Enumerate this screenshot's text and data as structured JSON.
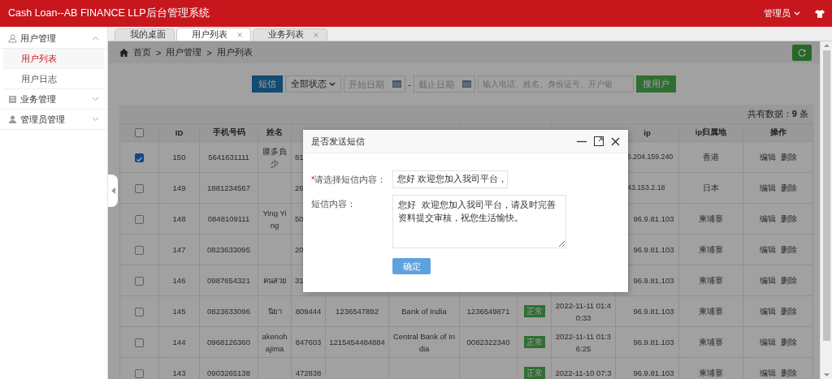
{
  "header": {
    "title": "Cash Loan--AB FINANCE LLP后台管理系统",
    "user": "管理员"
  },
  "sidebar": {
    "groups": [
      {
        "label": "用户管理",
        "expanded": true,
        "children": [
          {
            "label": "用户列表",
            "selected": true
          },
          {
            "label": "用户日志",
            "selected": false
          }
        ]
      },
      {
        "label": "业务管理",
        "expanded": false
      },
      {
        "label": "管理员管理",
        "expanded": false
      }
    ]
  },
  "tabs": [
    {
      "label": "我的桌面",
      "selected": false,
      "closable": false
    },
    {
      "label": "用户列表",
      "selected": true,
      "closable": true
    },
    {
      "label": "业务列表",
      "selected": false,
      "closable": true
    }
  ],
  "breadcrumb": {
    "items": [
      "首页",
      "用户管理",
      "用户列表"
    ],
    "separator": ">"
  },
  "toolbar": {
    "sms_button": "短信",
    "status_select": "全部状态",
    "start_date": {
      "placeholder": "开始日期"
    },
    "dash": "-",
    "end_date": {
      "placeholder": "截止日期"
    },
    "search": {
      "placeholder": "输入电话、姓名、身份证号、开户银"
    },
    "search_button": "搜用户"
  },
  "total": "共有数据：**9** 条",
  "table": {
    "select_all": {
      "checked": false
    },
    "columns": [
      "ID",
      "手机号码",
      "姓名",
      null,
      null,
      null,
      null,
      null,
      null,
      "ip",
      "ip归属地",
      "操作"
    ],
    "rows": [
      {
        "checked": true,
        "cells": [
          "150",
          "5641631111",
          "滕多負少",
          {
            "kind": "cut_end",
            "text": "81"
          },
          null,
          null,
          null,
          null,
          null,
          {
            "kind": "cut_start",
            "text": "6.204.159.240"
          },
          "香港"
        ],
        "actions": [
          "编辑",
          "删除"
        ]
      },
      {
        "checked": false,
        "cells": [
          "149",
          "1881234567",
          null,
          {
            "kind": "cut_end",
            "text": "26"
          },
          null,
          null,
          null,
          null,
          null,
          {
            "kind": "cut_start",
            "text": "43.153.2.18"
          },
          "日本"
        ],
        "actions": [
          "编辑",
          "删除"
        ]
      },
      {
        "checked": false,
        "cells": [
          "148",
          "0848109111",
          "Ying Ying",
          {
            "kind": "cut_end",
            "text": "50"
          },
          null,
          null,
          null,
          null,
          null,
          "96.9.81.103",
          "柬埔寨"
        ],
        "actions": [
          "编辑",
          "删除"
        ]
      },
      {
        "checked": false,
        "cells": [
          "147",
          "0823633095",
          null,
          {
            "kind": "cut_end",
            "text": "20"
          },
          null,
          null,
          null,
          null,
          null,
          "96.9.81.103",
          "柬埔寨"
        ],
        "actions": [
          "编辑",
          "删除"
        ]
      },
      {
        "checked": false,
        "cells": [
          "146",
          "0987654321",
          "คนสวย",
          {
            "kind": "cut_end",
            "text": "31"
          },
          null,
          null,
          null,
          null,
          null,
          "96.9.81.103",
          "柬埔寨"
        ],
        "actions": [
          "编辑",
          "删除"
        ]
      },
      {
        "checked": false,
        "cells": [
          "145",
          "0823633096",
          "นิยา",
          "809444",
          "1236547892",
          "Bank of India",
          "1236549871",
          {
            "kind": "badge",
            "text": "正常"
          },
          "2022-11-11 01:40:33",
          "96.9.81.103",
          "柬埔寨"
        ],
        "actions": [
          "编辑",
          "删除"
        ]
      },
      {
        "checked": false,
        "cells": [
          "144",
          "0968126360",
          "akenohajima",
          "847603",
          "1215454484884",
          "Central Bank of India",
          "0082322340",
          {
            "kind": "badge",
            "text": "正常"
          },
          "2022-11-11 01:36:25",
          "96.9.81.103",
          "柬埔寨"
        ],
        "actions": [
          "编辑",
          "删除"
        ]
      },
      {
        "checked": false,
        "cells": [
          "143",
          "0903265138",
          null,
          "472838",
          null,
          null,
          null,
          {
            "kind": "badge",
            "text": "正常"
          },
          "2022-11-10 07:3",
          "96.9.81.103",
          "柬埔寨"
        ],
        "actions": [
          "编辑",
          "删除"
        ]
      }
    ]
  },
  "dialog": {
    "title": "是否发送短信",
    "required_mark": "*",
    "select_label": "请选择短信内容：",
    "select_value": "您好 欢迎您加入我司平台，",
    "content_label": "短信内容：",
    "content": "您好  欢迎您加入我司平台，请及时完善资料提交审核，祝您生活愉快。",
    "confirm": "确定"
  }
}
